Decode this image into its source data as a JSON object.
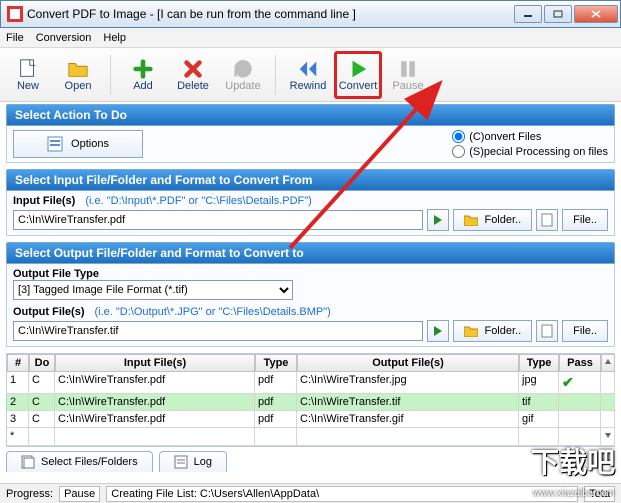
{
  "window": {
    "title": "Convert PDF to Image - [I can be run from the command line ]"
  },
  "menu": {
    "file": "File",
    "conversion": "Conversion",
    "help": "Help"
  },
  "toolbar": {
    "new": "New",
    "open": "Open",
    "add": "Add",
    "delete": "Delete",
    "update": "Update",
    "rewind": "Rewind",
    "convert": "Convert",
    "pause": "Pause"
  },
  "sections": {
    "action_hdr": "Select Action To Do",
    "input_hdr": "Select Input File/Folder and Format to Convert From",
    "output_hdr": "Select Output File/Folder and Format to Convert to"
  },
  "action": {
    "convert_files": "(C)onvert Files",
    "special": "(S)pecial Processing on files",
    "options_btn": "Options"
  },
  "input": {
    "label": "Input File(s)",
    "hint": "(i.e. \"D:\\Input\\*.PDF\"  or  \"C:\\Files\\Details.PDF\")",
    "value": "C:\\In\\WireTransfer.pdf",
    "folder_btn": "Folder..",
    "file_btn": "File.."
  },
  "output": {
    "type_label": "Output File Type",
    "type_value": "[3] Tagged Image File Format (*.tif)",
    "label": "Output File(s)",
    "hint": "(i.e. \"D:\\Output\\*.JPG\"  or  \"C:\\Files\\Details.BMP\")",
    "value": "C:\\In\\WireTransfer.tif",
    "folder_btn": "Folder..",
    "file_btn": "File.."
  },
  "grid": {
    "cols": {
      "num": "#",
      "do": "Do",
      "in": "Input File(s)",
      "type1": "Type",
      "out": "Output File(s)",
      "type2": "Type",
      "pass": "Pass"
    },
    "rows": [
      {
        "n": "1",
        "do": "C",
        "in": "C:\\In\\WireTransfer.pdf",
        "t1": "pdf",
        "out": "C:\\In\\WireTransfer.jpg",
        "t2": "jpg",
        "pass": "✔"
      },
      {
        "n": "2",
        "do": "C",
        "in": "C:\\In\\WireTransfer.pdf",
        "t1": "pdf",
        "out": "C:\\In\\WireTransfer.tif",
        "t2": "tif",
        "pass": ""
      },
      {
        "n": "3",
        "do": "C",
        "in": "C:\\In\\WireTransfer.pdf",
        "t1": "pdf",
        "out": "C:\\In\\WireTransfer.gif",
        "t2": "gif",
        "pass": ""
      }
    ],
    "star": "*"
  },
  "tabs": {
    "select": "Select Files/Folders",
    "log": "Log"
  },
  "status": {
    "progress_lbl": "Progress:",
    "progress_val": "Pause",
    "creating": "Creating File List:  C:\\Users\\Allen\\AppData\\",
    "total": "Tota"
  },
  "watermark": {
    "text": "下载吧",
    "url": "www.xiazaiba.com"
  }
}
